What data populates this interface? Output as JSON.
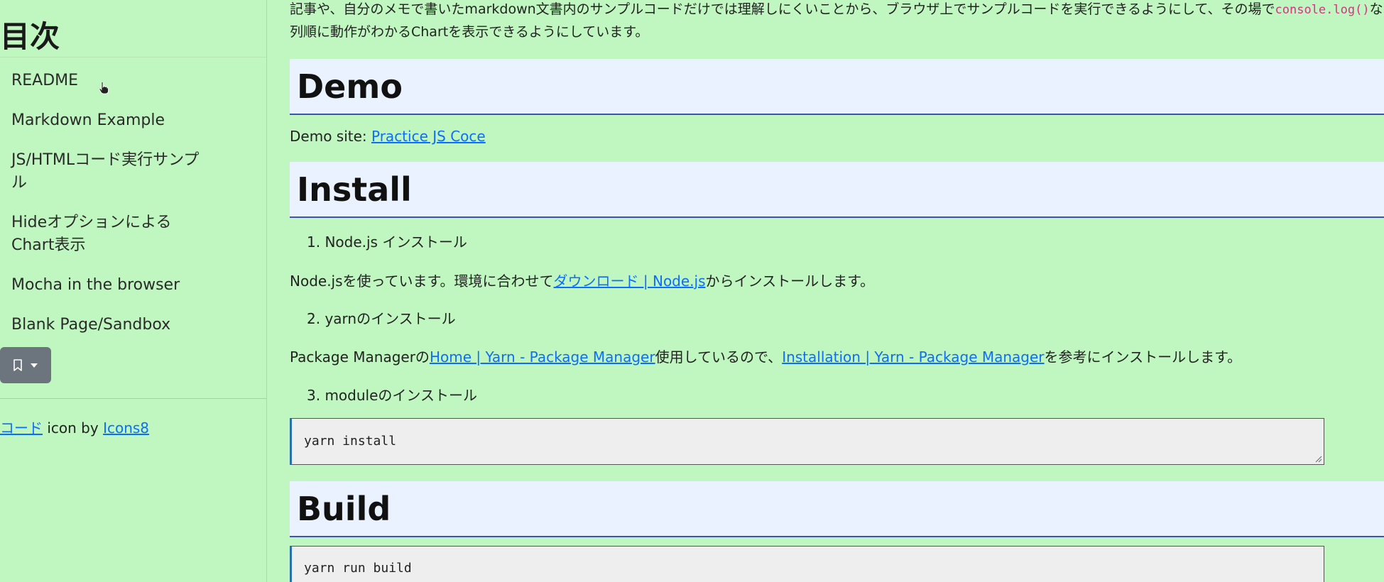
{
  "sidebar": {
    "title": "目次",
    "items": [
      {
        "label": "README"
      },
      {
        "label": "Markdown Example"
      },
      {
        "label": "JS/HTMLコード実行サンプル"
      },
      {
        "label": "Hideオプションによる Chart表示"
      },
      {
        "label": "Mocha in the browser"
      },
      {
        "label": "Blank Page/Sandbox"
      }
    ],
    "bookmark_icon": "bookmark-icon",
    "caret_icon": "caret-down-icon",
    "credit": {
      "link1": "コード",
      "middle": " icon by ",
      "link2": "Icons8"
    }
  },
  "main": {
    "intro_line1_a": "記事や、自分のメモで書いたmarkdown文書内のサンプルコードだけでは理解しにくいことから、ブラウザ上でサンプルコードを実行できるようにして、その場で",
    "intro_line1_code": "console.log()",
    "intro_line1_b": "な",
    "intro_line2": "列順に動作がわかるChartを表示できるようにしています。",
    "demo": {
      "heading": "Demo",
      "site_prefix": "Demo site: ",
      "site_link": "Practice JS Coce"
    },
    "install": {
      "heading": "Install",
      "step1": "1. Node.js インストール",
      "step1_text_a": "Node.jsを使っています。環境に合わせて",
      "step1_link": "ダウンロード | Node.js",
      "step1_text_b": "からインストールします。",
      "step2": "2. yarnのインストール",
      "step2_text_a": "Package Managerの",
      "step2_link1": "Home | Yarn - Package Manager",
      "step2_text_b": "使用しているので、",
      "step2_link2": "Installation | Yarn - Package Manager",
      "step2_text_c": "を参考にインストールします。",
      "step3": "3. moduleのインストール",
      "code": "yarn install"
    },
    "build": {
      "heading": "Build",
      "code": "yarn run build"
    }
  },
  "colors": {
    "background": "#c0f7c0",
    "heading_bg": "#ebf2ff",
    "heading_border": "#3a55b0",
    "link": "#0d6efd",
    "button_bg": "#6c757d",
    "inline_code": "#d63384"
  }
}
